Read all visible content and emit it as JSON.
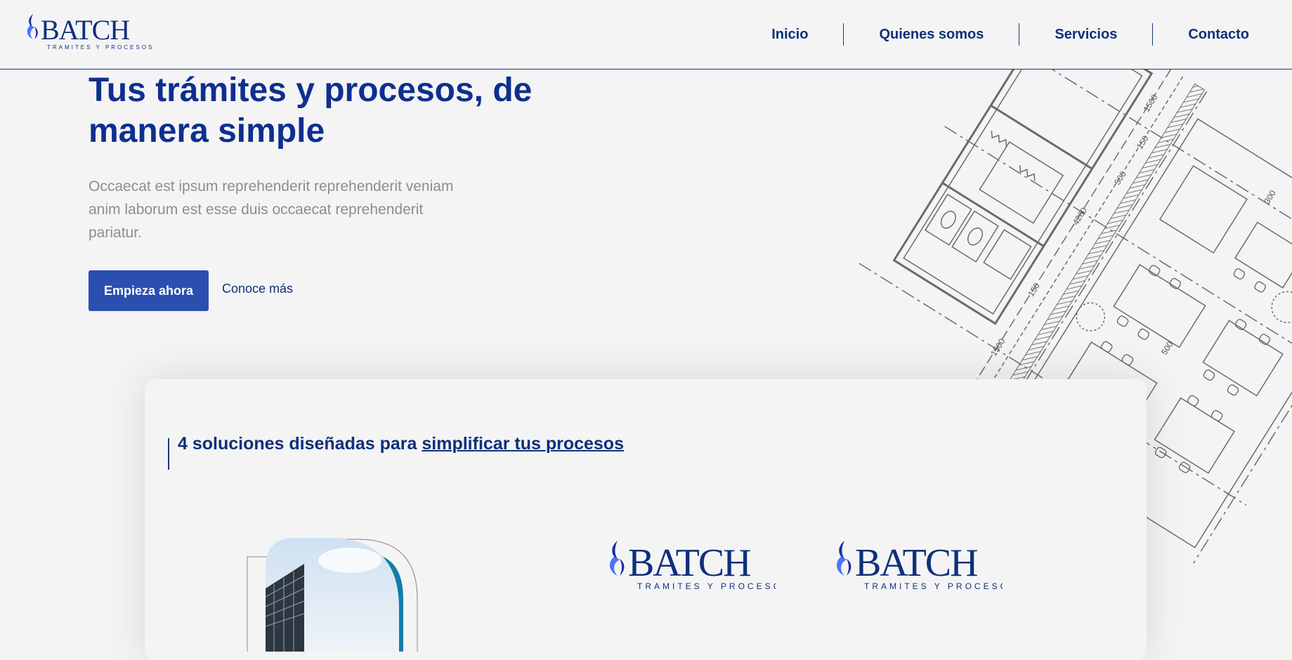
{
  "header": {
    "logo": {
      "name": "BATCH",
      "tagline": "TRAMITES Y PROCESOS",
      "brand_color": "#0f2f7a",
      "flame_colors": [
        "#1a2fa0",
        "#4a73ff"
      ]
    },
    "nav": [
      "Inicio",
      "Quienes somos",
      "Servicios",
      "Contacto"
    ]
  },
  "hero": {
    "title": "Tus trámites y procesos, de manera simple",
    "description": "Occaecat est ipsum reprehenderit reprehenderit veniam anim laborum est esse duis occaecat reprehenderit pariatur.",
    "primary_button": "Empieza ahora",
    "secondary_link": "Conoce más",
    "blueprint_dimensions": [
      "1500",
      "150",
      "4260",
      "500",
      "150",
      "1500",
      "300",
      "500"
    ]
  },
  "solutions": {
    "title_prefix": "4 soluciones diseñadas para",
    "title_link": "simplificar tus procesos",
    "logos": [
      {
        "name": "BATCH",
        "tagline": "TRAMITES Y PROCESOS"
      },
      {
        "name": "BATCH",
        "tagline": "TRAMITES Y PROCESOS"
      }
    ]
  },
  "colors": {
    "primary": "#0f2f7a",
    "button": "#2a4fb0",
    "accent_teal": "#0f7fa6",
    "body_text": "#8c8c94",
    "background": "#f4f4f5"
  }
}
